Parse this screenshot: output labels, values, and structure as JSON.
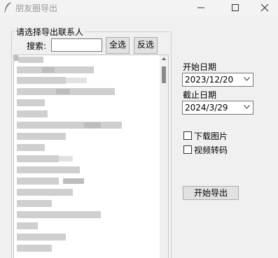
{
  "window": {
    "title": "朋友圈导出"
  },
  "contacts": {
    "group_title": "请选择导出联系人",
    "search_label": "搜索:",
    "search_value": "",
    "select_all_label": "全选",
    "invert_label": "反选"
  },
  "export": {
    "start_date_label": "开始日期",
    "start_date_value": "2023/12/20",
    "end_date_label": "截止日期",
    "end_date_value": "2024/3/29",
    "download_images_label": "下载图片",
    "download_images_checked": false,
    "video_transcode_label": "视频转码",
    "video_transcode_checked": false,
    "start_button_label": "开始导出"
  }
}
